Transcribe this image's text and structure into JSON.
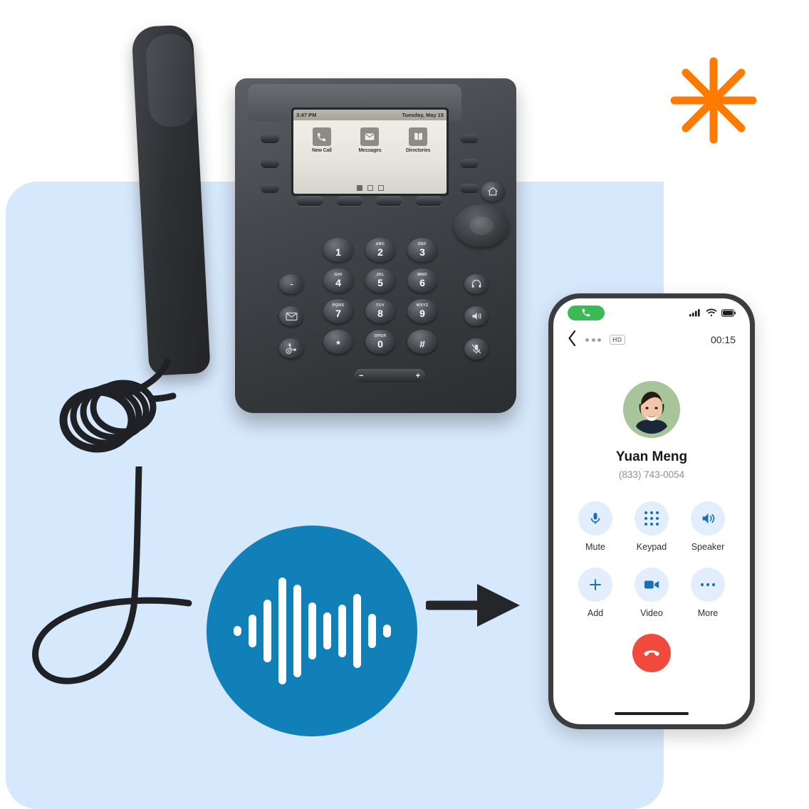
{
  "theme": {
    "panel_bg": "#d6e8fb",
    "accent_blue": "#1180b8",
    "phone_accent": "#1a6fb5",
    "control_bg": "#e2eefb",
    "end_call_red": "#ef4a3c",
    "call_green": "#3cba54",
    "avatar_green": "#a8c49a",
    "starburst_orange": "#ff7a00",
    "doodle_black": "#1f2124"
  },
  "desk_phone": {
    "screen": {
      "time": "3:47 PM",
      "date": "Tuesday, May 15",
      "menu_items": [
        {
          "label": "New Call",
          "icon": "handset-icon"
        },
        {
          "label": "Messages",
          "icon": "envelope-icon"
        },
        {
          "label": "Directories",
          "icon": "book-icon"
        }
      ],
      "page_dots": [
        true,
        false,
        false
      ]
    },
    "soft_keys": [
      "softkey-1",
      "softkey-2",
      "softkey-3",
      "softkey-4"
    ],
    "line_keys_left": [
      "line-key-1",
      "line-key-2",
      "line-key-3"
    ],
    "line_keys_right": [
      "line-key-4",
      "line-key-5",
      "line-key-6"
    ],
    "side_buttons_left": [
      {
        "name": "transfer-button",
        "icon": "transfer-icon"
      },
      {
        "name": "messages-button",
        "icon": "envelope-icon"
      },
      {
        "name": "hold-button",
        "icon": "hold-icon"
      }
    ],
    "side_buttons_right": [
      {
        "name": "home-button",
        "icon": "home-icon"
      },
      {
        "name": "headset-button",
        "icon": "headset-icon"
      },
      {
        "name": "speaker-button",
        "icon": "speaker-icon"
      },
      {
        "name": "mute-button",
        "icon": "mic-mute-icon"
      }
    ],
    "keypad": [
      [
        {
          "num": "1",
          "sub": ""
        },
        {
          "num": "2",
          "sub": "ABC"
        },
        {
          "num": "3",
          "sub": "DEF"
        }
      ],
      [
        {
          "num": "4",
          "sub": "GHI"
        },
        {
          "num": "5",
          "sub": "JKL"
        },
        {
          "num": "6",
          "sub": "MNO"
        }
      ],
      [
        {
          "num": "7",
          "sub": "PQRS"
        },
        {
          "num": "8",
          "sub": "TUV"
        },
        {
          "num": "9",
          "sub": "WXYZ"
        }
      ],
      [
        {
          "num": "*",
          "sub": ""
        },
        {
          "num": "0",
          "sub": "OPER"
        },
        {
          "num": "#",
          "sub": ""
        }
      ]
    ],
    "volume": {
      "down": "−",
      "up": "+"
    }
  },
  "smartphone": {
    "status_bar": {
      "call_indicator_icon": "handset-icon",
      "signal_icon": "cellular-signal-icon",
      "wifi_icon": "wifi-icon",
      "battery_icon": "battery-icon"
    },
    "nav_bar": {
      "back_icon": "chevron-left-icon",
      "more_icon": "ellipsis-icon",
      "hd_badge": "HD",
      "timer": "00:15"
    },
    "caller": {
      "avatar_icon": "contact-avatar",
      "name": "Yuan Meng",
      "number": "(833) 743-0054"
    },
    "controls": [
      {
        "label": "Mute",
        "icon": "microphone-icon"
      },
      {
        "label": "Keypad",
        "icon": "keypad-icon"
      },
      {
        "label": "Speaker",
        "icon": "speaker-icon"
      },
      {
        "label": "Add",
        "icon": "plus-icon"
      },
      {
        "label": "Video",
        "icon": "video-camera-icon"
      },
      {
        "label": "More",
        "icon": "ellipsis-icon"
      }
    ],
    "end_call": {
      "label": "End call",
      "icon": "end-call-icon"
    },
    "home_indicator": "home-indicator"
  },
  "decor": {
    "waveform": {
      "icon": "audio-waveform-icon",
      "bars": [
        14,
        46,
        88,
        150,
        130,
        80,
        52,
        74,
        104,
        48,
        18
      ]
    },
    "arrow": {
      "icon": "arrow-right-icon"
    },
    "starburst": {
      "icon": "starburst-icon",
      "points": 8
    },
    "loop_doodle": {
      "icon": "loop-doodle-icon"
    }
  }
}
